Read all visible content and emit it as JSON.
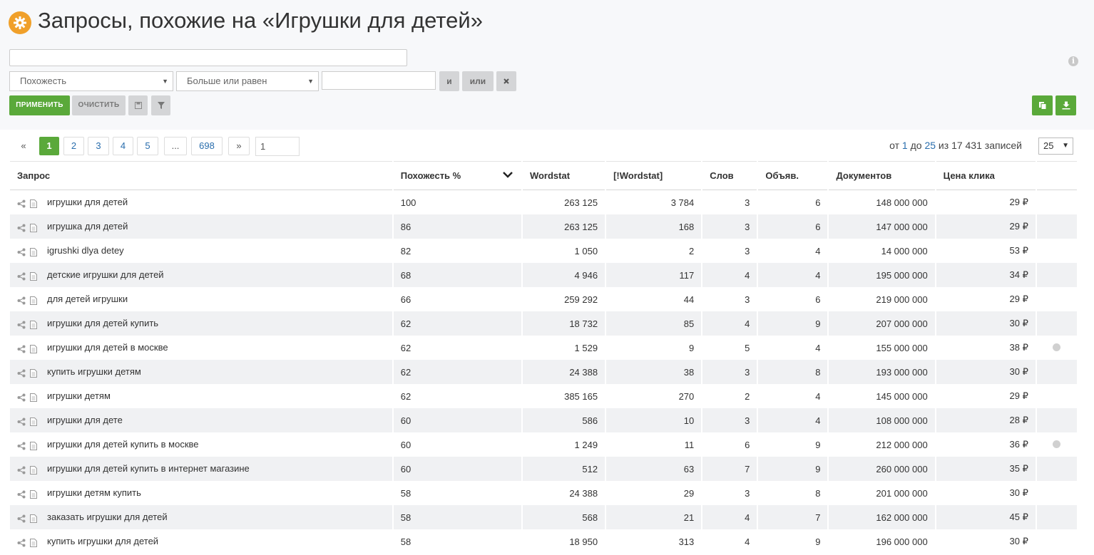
{
  "header": {
    "title": "Запросы, похожие на «Игрушки для детей»"
  },
  "filter": {
    "search_value": "",
    "field_select": "Похожесть",
    "condition_select": "Больше или равен",
    "value_input": "",
    "and_label": "и",
    "or_label": "или",
    "apply_label": "ПРИМЕНИТЬ",
    "clear_label": "ОЧИСТИТЬ"
  },
  "pagination": {
    "prev": "«",
    "pages": [
      "1",
      "2",
      "3",
      "4",
      "5",
      "...",
      "698"
    ],
    "active_page": "1",
    "next": "»",
    "goto_value": "1",
    "records_prefix": "от ",
    "records_from": "1",
    "records_mid1": " до ",
    "records_to": "25",
    "records_mid2": " из ",
    "records_total": "17 431",
    "records_suffix": " записей",
    "per_page": "25"
  },
  "table": {
    "columns": [
      "Запрос",
      "Похожесть %",
      "Wordstat",
      "[!Wordstat]",
      "Слов",
      "Объяв.",
      "Документов",
      "Цена клика"
    ],
    "rows": [
      [
        "игрушки для детей",
        "100",
        "263 125",
        "3 784",
        "3",
        "6",
        "148 000 000",
        "29 ₽",
        ""
      ],
      [
        "игрушка для детей",
        "86",
        "263 125",
        "168",
        "3",
        "6",
        "147 000 000",
        "29 ₽",
        ""
      ],
      [
        "igrushki dlya detey",
        "82",
        "1 050",
        "2",
        "3",
        "4",
        "14 000 000",
        "53 ₽",
        ""
      ],
      [
        "детские игрушки для детей",
        "68",
        "4 946",
        "117",
        "4",
        "4",
        "195 000 000",
        "34 ₽",
        ""
      ],
      [
        "для детей игрушки",
        "66",
        "259 292",
        "44",
        "3",
        "6",
        "219 000 000",
        "29 ₽",
        ""
      ],
      [
        "игрушки для детей купить",
        "62",
        "18 732",
        "85",
        "4",
        "9",
        "207 000 000",
        "30 ₽",
        ""
      ],
      [
        "игрушки для детей в москве",
        "62",
        "1 529",
        "9",
        "5",
        "4",
        "155 000 000",
        "38 ₽",
        "globe"
      ],
      [
        "купить игрушки детям",
        "62",
        "24 388",
        "38",
        "3",
        "8",
        "193 000 000",
        "30 ₽",
        ""
      ],
      [
        "игрушки детям",
        "62",
        "385 165",
        "270",
        "2",
        "4",
        "145 000 000",
        "29 ₽",
        ""
      ],
      [
        "игрушки для дете",
        "60",
        "586",
        "10",
        "3",
        "4",
        "108 000 000",
        "28 ₽",
        ""
      ],
      [
        "игрушки для детей купить в москве",
        "60",
        "1 249",
        "11",
        "6",
        "9",
        "212 000 000",
        "36 ₽",
        "globe"
      ],
      [
        "игрушки для детей купить в интернет магазине",
        "60",
        "512",
        "63",
        "7",
        "9",
        "260 000 000",
        "35 ₽",
        ""
      ],
      [
        "игрушки детям купить",
        "58",
        "24 388",
        "29",
        "3",
        "8",
        "201 000 000",
        "30 ₽",
        ""
      ],
      [
        "заказать игрушки для детей",
        "58",
        "568",
        "21",
        "4",
        "7",
        "162 000 000",
        "45 ₽",
        ""
      ],
      [
        "купить игрушки для детей",
        "58",
        "18 950",
        "313",
        "4",
        "9",
        "196 000 000",
        "30 ₽",
        ""
      ]
    ]
  },
  "colors": {
    "brand_green": "#5aa93a",
    "logo_orange": "#f0a02a",
    "link_blue": "#2a6ead"
  }
}
